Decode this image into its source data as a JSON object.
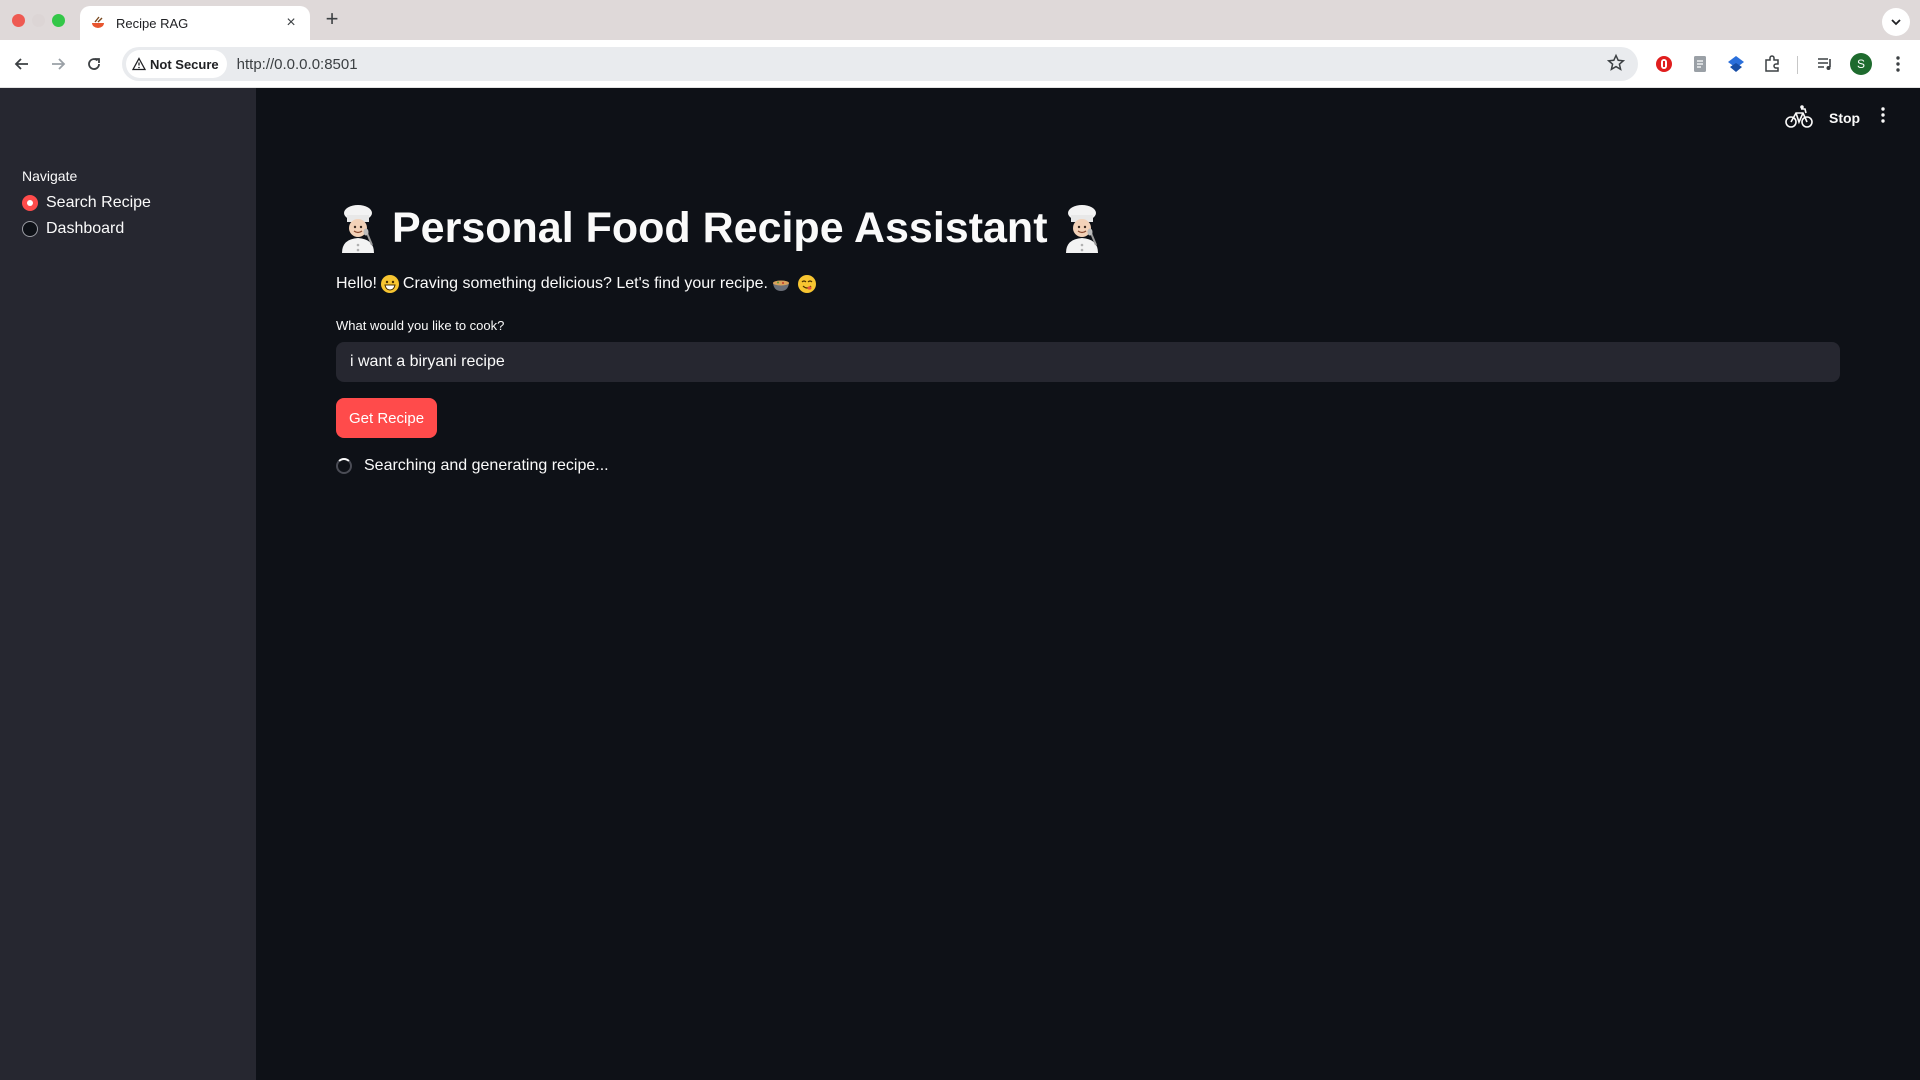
{
  "browser": {
    "tab_title": "Recipe RAG",
    "security_label": "Not Secure",
    "url": "http://0.0.0.0:8501",
    "profile_initial": "S"
  },
  "sidebar": {
    "nav_label": "Navigate",
    "options": [
      {
        "label": "Search Recipe",
        "selected": true
      },
      {
        "label": "Dashboard",
        "selected": false
      }
    ]
  },
  "header": {
    "stop_label": "Stop"
  },
  "main": {
    "title": "Personal Food Recipe Assistant",
    "greeting_hello": "Hello!",
    "greeting_text": "Craving something delicious? Let's find your recipe.",
    "input_label": "What would you like to cook?",
    "input_value": "i want a biryani recipe",
    "button_label": "Get Recipe",
    "status_text": "Searching and generating recipe..."
  },
  "colors": {
    "accent": "#ff4b4b",
    "app_background": "#0e1117",
    "sidebar_background": "#262730",
    "text": "#fafafa"
  }
}
